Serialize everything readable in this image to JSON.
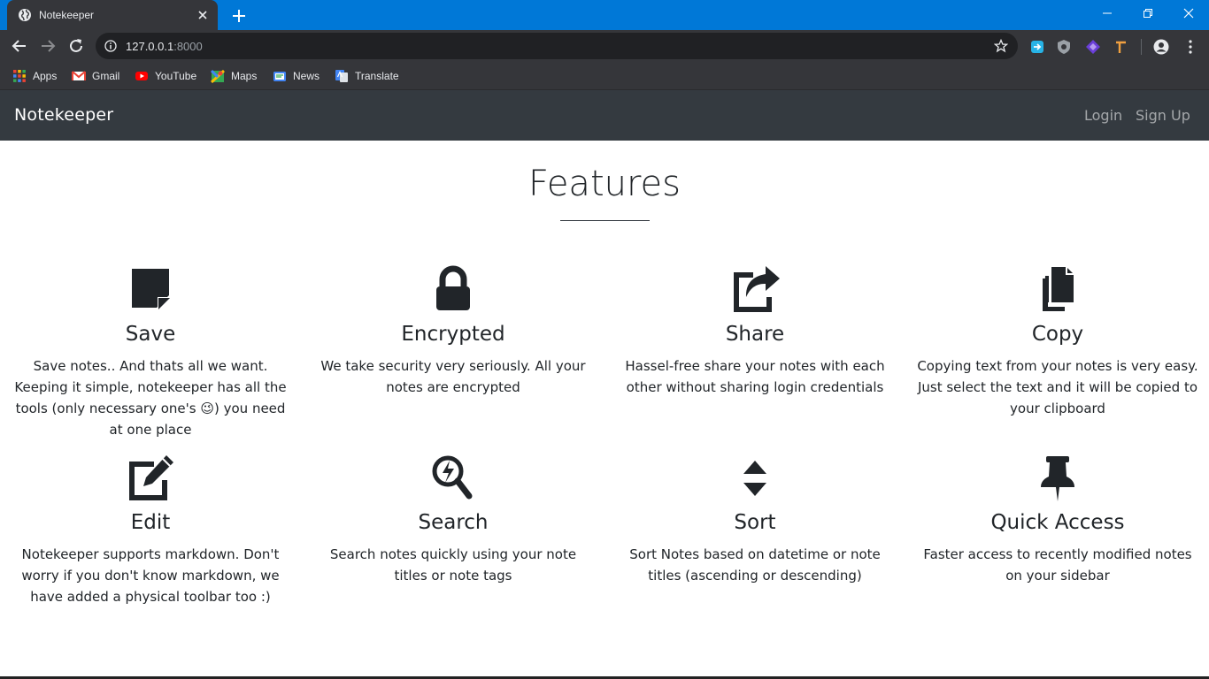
{
  "browser": {
    "tab_title": "Notekeeper",
    "url_host": "127.0.0.1",
    "url_port": ":8000",
    "bookmarks": [
      {
        "label": "Apps",
        "icon": "apps-grid-icon"
      },
      {
        "label": "Gmail",
        "icon": "gmail-icon"
      },
      {
        "label": "YouTube",
        "icon": "youtube-icon"
      },
      {
        "label": "Maps",
        "icon": "maps-icon"
      },
      {
        "label": "News",
        "icon": "news-icon"
      },
      {
        "label": "Translate",
        "icon": "translate-icon"
      }
    ]
  },
  "navbar": {
    "brand": "Notekeeper",
    "login": "Login",
    "signup": "Sign Up"
  },
  "features": {
    "title": "Features",
    "items": [
      {
        "title": "Save",
        "icon": "sticky-note-icon",
        "text": "Save notes.. And thats all we want. Keeping it simple, notekeeper has all the tools (only necessary one's 😉) you need at one place"
      },
      {
        "title": "Encrypted",
        "icon": "lock-icon",
        "text": "We take security very seriously. All your notes are encrypted"
      },
      {
        "title": "Share",
        "icon": "share-square-icon",
        "text": "Hassel-free share your notes with each other without sharing login credentials"
      },
      {
        "title": "Copy",
        "icon": "copy-icon",
        "text": "Copying text from your notes is very easy. Just select the text and it will be copied to your clipboard"
      },
      {
        "title": "Edit",
        "icon": "edit-icon",
        "text": "Notekeeper supports markdown. Don't worry if you don't know markdown, we have added a physical toolbar too :)"
      },
      {
        "title": "Search",
        "icon": "search-bolt-icon",
        "text": "Search notes quickly using your note titles or note tags"
      },
      {
        "title": "Sort",
        "icon": "sort-icon",
        "text": "Sort Notes based on datetime or note titles (ascending or descending)"
      },
      {
        "title": "Quick Access",
        "icon": "thumbtack-icon",
        "text": "Faster access to recently modified notes on your sidebar"
      }
    ]
  },
  "colors": {
    "titlebar": "#0078d7",
    "chrome_dark": "#35363a",
    "navbar_bg": "#343a40",
    "text_dark": "#212529"
  }
}
